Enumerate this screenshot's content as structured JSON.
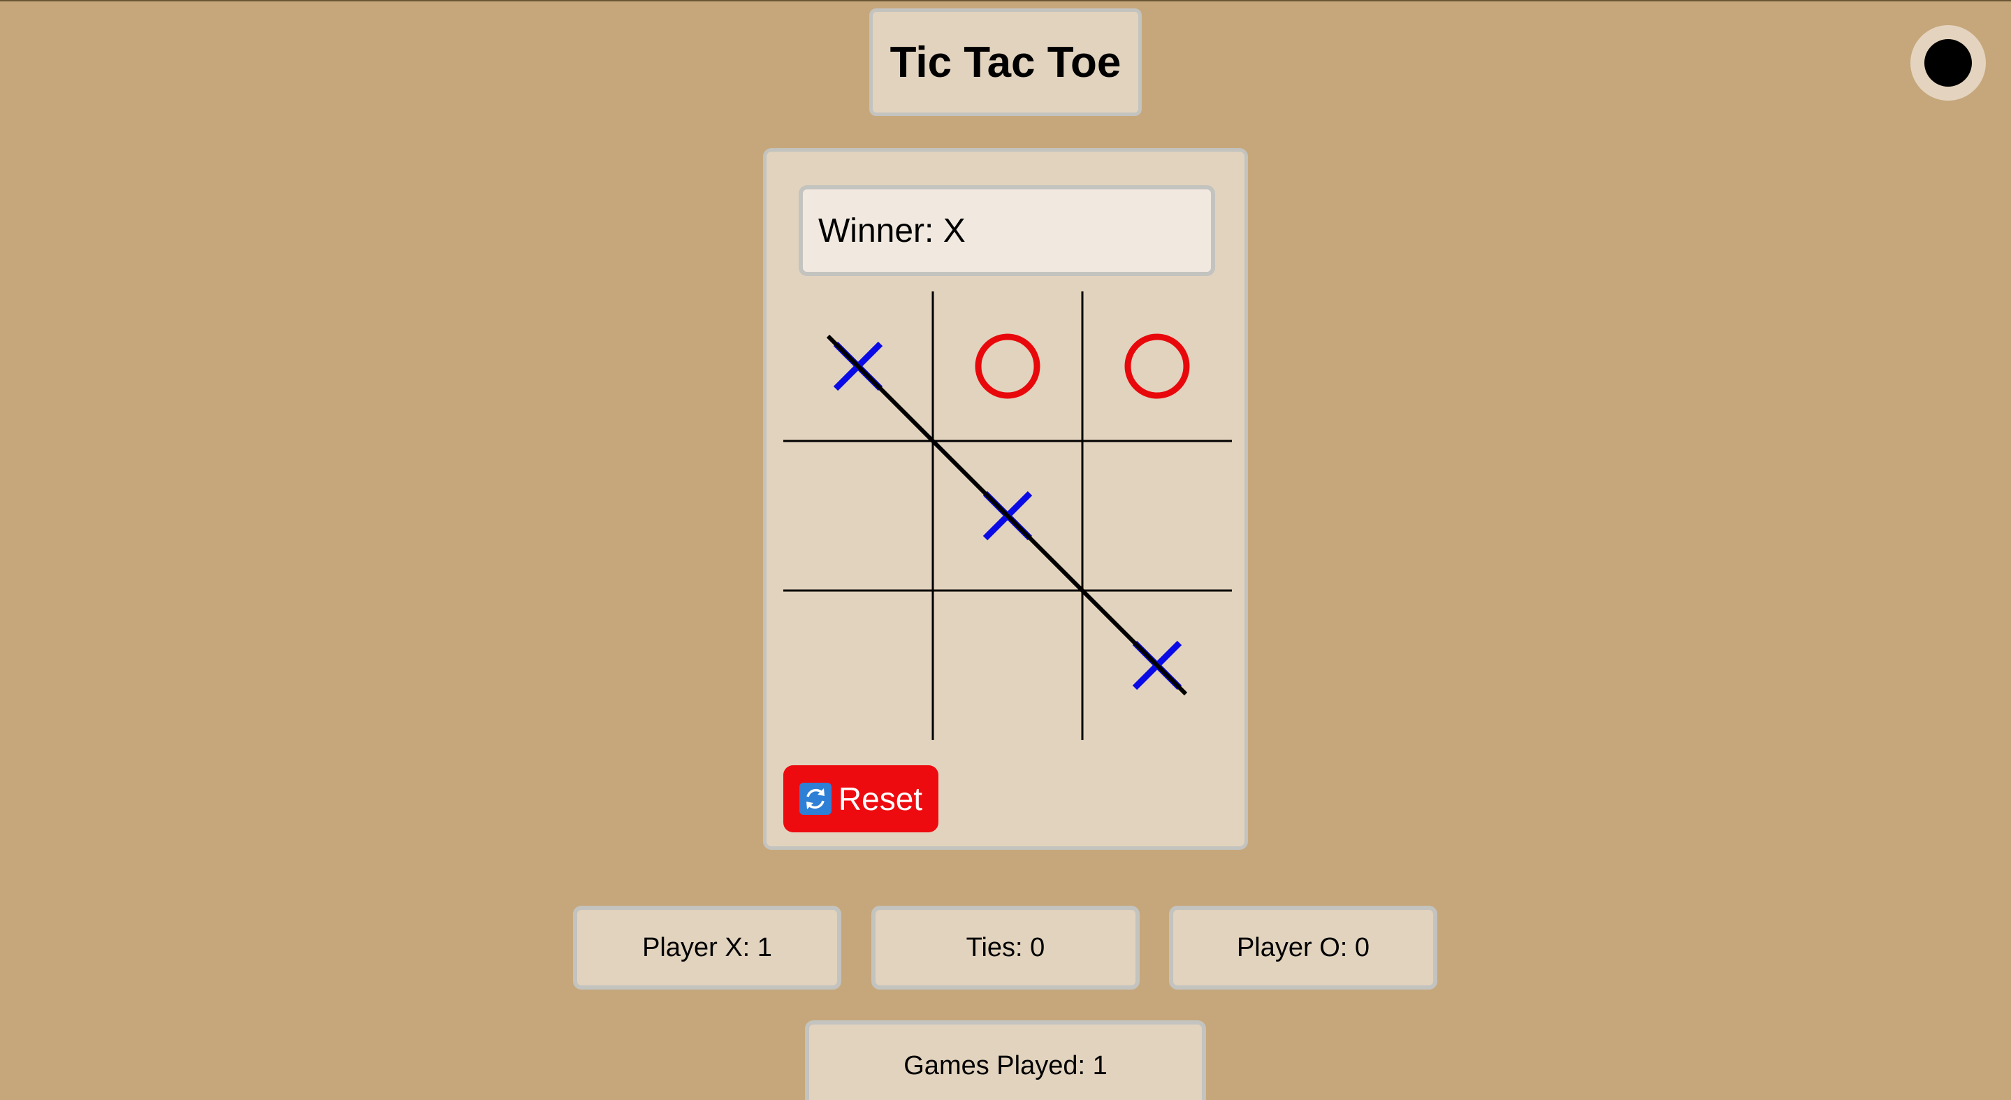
{
  "app": {
    "title": "Tic Tac Toe"
  },
  "theme_toggle": {
    "icon": "dark-mode-circle-icon"
  },
  "status": {
    "text": "Winner: X"
  },
  "board": {
    "cells": [
      "X",
      "O",
      "O",
      "",
      "X",
      "",
      "",
      "",
      "X"
    ],
    "winning_line": "diagonal-top-left-to-bottom-right",
    "x_color": "#0a0ae6",
    "o_color": "#e8080c",
    "line_color": "#000000"
  },
  "reset": {
    "label": "Reset",
    "icon": "refresh-icon",
    "color": "#ee0b0f"
  },
  "scores": {
    "player_x": "Player X: 1",
    "ties": "Ties: 0",
    "player_o": "Player O: 0"
  },
  "games_played": "Games Played: 1"
}
